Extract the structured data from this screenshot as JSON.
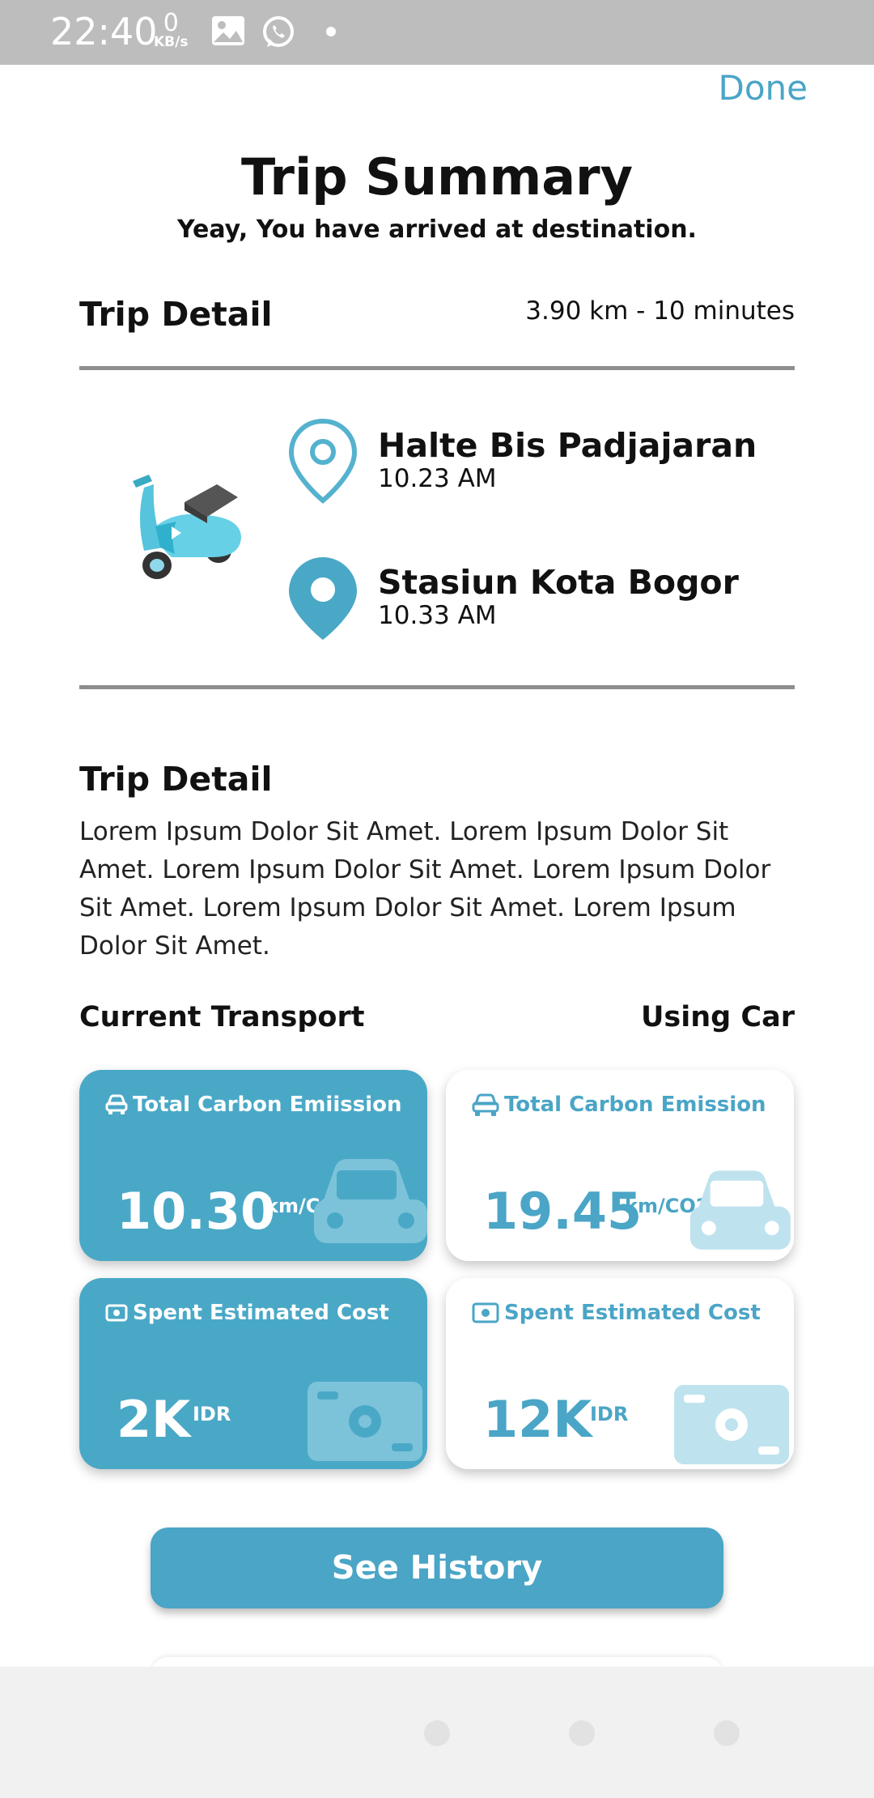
{
  "status_bar": {
    "time": "22:40",
    "net_speed_value": "0",
    "net_speed_unit": "KB/s",
    "icons": [
      "image-icon",
      "whatsapp-icon",
      "dot-icon"
    ]
  },
  "header": {
    "done_label": "Done",
    "title": "Trip Summary",
    "subtitle": "Yeay, You have arrived at destination."
  },
  "trip": {
    "heading": "Trip Detail",
    "meta": "3.90 km - 10 minutes",
    "vehicle_icon": "scooter-icon",
    "origin": {
      "name": "Halte Bis Padjajaran",
      "time": "10.23 AM"
    },
    "destination": {
      "name": "Stasiun Kota Bogor",
      "time": "10.33 AM"
    }
  },
  "detail": {
    "heading": "Trip Detail",
    "text": "Lorem Ipsum Dolor Sit Amet. Lorem Ipsum Dolor Sit Amet. Lorem Ipsum Dolor Sit Amet. Lorem Ipsum Dolor Sit Amet. Lorem Ipsum Dolor Sit Amet. Lorem Ipsum Dolor Sit Amet."
  },
  "transport": {
    "current_label": "Current Transport",
    "using_label": "Using Car"
  },
  "cards": {
    "current_emission": {
      "title": "Total Carbon Emiission",
      "value": "10.30",
      "unit": "km/CO2"
    },
    "car_emission": {
      "title": "Total Carbon Emission",
      "value": "19.45",
      "unit": "km/CO2"
    },
    "current_cost": {
      "title": "Spent Estimated Cost",
      "value": "2K",
      "unit": "IDR"
    },
    "car_cost": {
      "title": "Spent Estimated Cost",
      "value": "12K",
      "unit": "IDR"
    }
  },
  "actions": {
    "history_label": "See History"
  },
  "colors": {
    "accent": "#4aa5c6",
    "card_blue": "#4aa8c7",
    "divider": "#8e8e8e",
    "status_bar": "#bdbdbd"
  }
}
